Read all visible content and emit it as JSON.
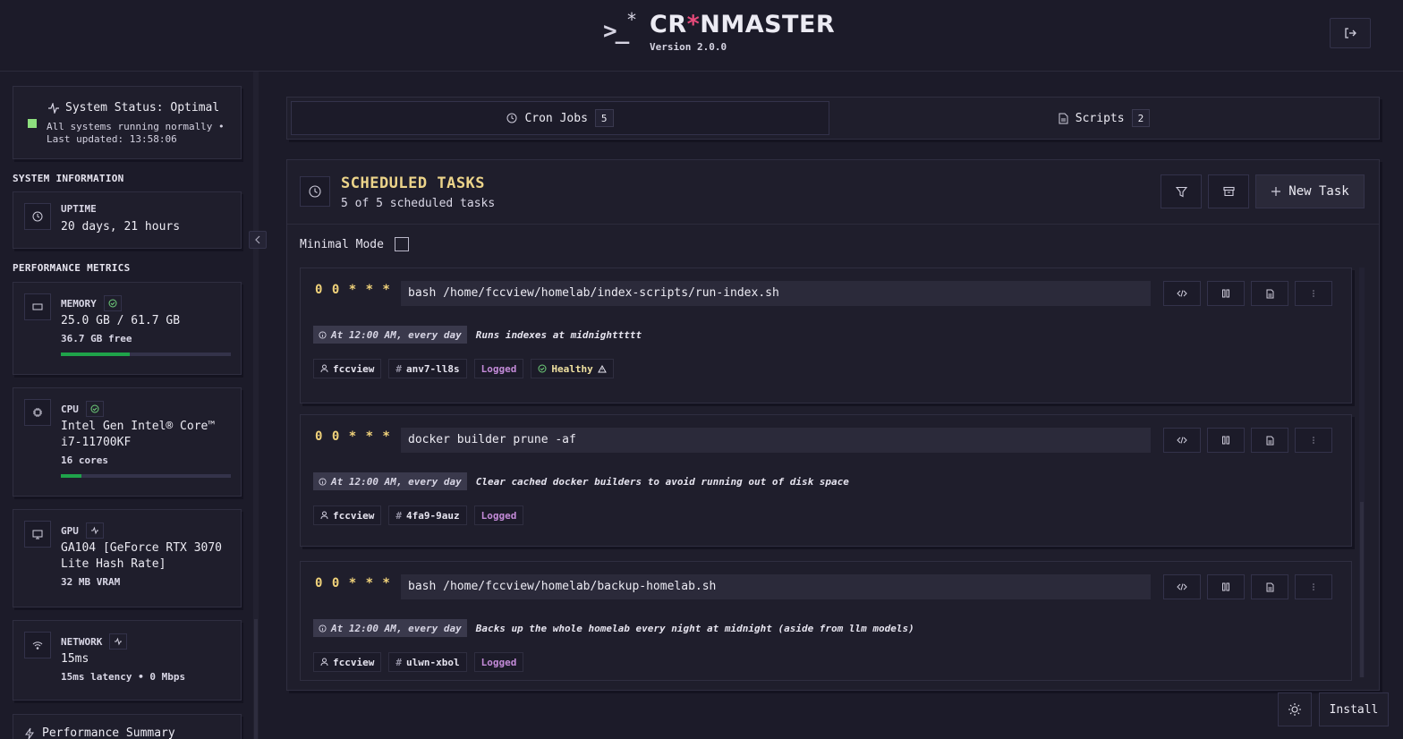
{
  "header": {
    "title_prefix": "CR",
    "title_o": "*",
    "title_suffix": "NMASTER",
    "version": "Version 2.0.0",
    "logout_icon": "logout-icon"
  },
  "sidebar": {
    "status": {
      "title": "System Status: Optimal",
      "subtitle": "All systems running normally • Last updated: 13:58:06",
      "color": "#8ee07f"
    },
    "system_info_title": "SYSTEM INFORMATION",
    "uptime": {
      "label": "UPTIME",
      "value": "20 days, 21 hours"
    },
    "performance_title": "PERFORMANCE METRICS",
    "memory": {
      "label": "MEMORY",
      "value": "25.0 GB / 61.7 GB",
      "sub": "36.7 GB free",
      "usage_fraction": 0.405
    },
    "cpu": {
      "label": "CPU",
      "value": "Intel Gen Intel® Core™ i7-11700KF",
      "sub": "16 cores",
      "usage_fraction": 0.12
    },
    "gpu": {
      "label": "GPU",
      "value": "GA104 [GeForce RTX 3070 Lite Hash Rate]",
      "sub": "32 MB VRAM"
    },
    "network": {
      "label": "NETWORK",
      "value": "15ms",
      "sub": "15ms latency • 0 Mbps"
    },
    "performance_summary": "Performance Summary"
  },
  "tabs": [
    {
      "label": "Cron Jobs",
      "count": "5"
    },
    {
      "label": "Scripts",
      "count": "2"
    }
  ],
  "panel": {
    "title": "SCHEDULED TASKS",
    "subtitle": "5 of 5 scheduled tasks",
    "new_task_label": "New Task",
    "minimal_mode_label": "Minimal Mode"
  },
  "jobs": [
    {
      "schedule": "0 0 * * *",
      "command": "bash /home/fccview/homelab/index-scripts/run-index.sh",
      "human": "At 12:00 AM, every day",
      "description": "Runs indexes at midnighttttt",
      "user": "fccview",
      "id": "anv7-ll8s",
      "logged": "Logged",
      "health": "Healthy"
    },
    {
      "schedule": "0 0 * * *",
      "command": "docker builder prune -af",
      "human": "At 12:00 AM, every day",
      "description": "Clear cached docker builders to avoid running out of disk space",
      "user": "fccview",
      "id": "4fa9-9auz",
      "logged": "Logged"
    },
    {
      "schedule": "0 0 * * *",
      "command": "bash /home/fccview/homelab/backup-homelab.sh",
      "human": "At 12:00 AM, every day",
      "description": "Backs up the whole homelab every night at midnight (aside from llm models)",
      "user": "fccview",
      "id": "ulwn-xbol",
      "logged": "Logged"
    }
  ],
  "footer": {
    "install_label": "Install"
  },
  "colors": {
    "accent_yellow": "#f0d27a",
    "logged_purple": "#c38ad8",
    "progress_green": "#1fa34a",
    "logo_red": "#e64a7a"
  }
}
